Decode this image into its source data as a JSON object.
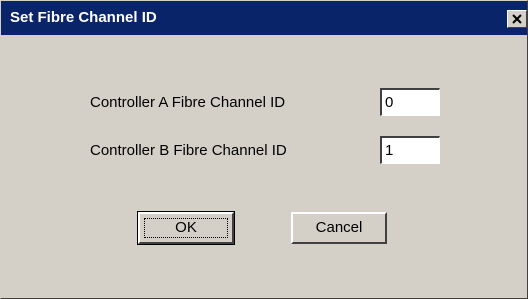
{
  "dialog": {
    "title": "Set Fibre Channel ID",
    "fields": [
      {
        "label": "Controller A Fibre Channel ID",
        "value": "0"
      },
      {
        "label": "Controller B Fibre Channel ID",
        "value": "1"
      }
    ],
    "ok_label": "OK",
    "cancel_label": "Cancel"
  },
  "colors": {
    "title_bar": "#0a246a",
    "dialog_bg": "#d4d0c8"
  },
  "icons": {
    "close": "close-icon"
  }
}
